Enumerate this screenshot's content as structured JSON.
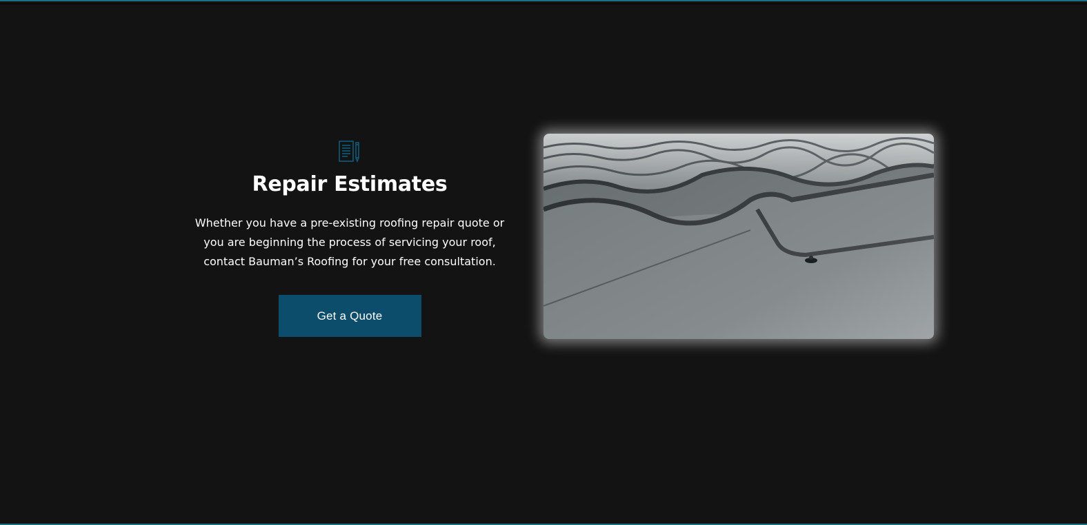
{
  "section": {
    "icon": "document-pencil-icon",
    "title": "Repair Estimates",
    "description": "Whether you have a pre-existing roofing repair quote or you are beginning the process of servicing your roof, contact Bauman’s Roofing for your free consultation.",
    "button_label": "Get a Quote"
  },
  "image": {
    "subject": "metal roof tiles photo"
  },
  "colors": {
    "background": "#131313",
    "accent": "#0b4d6b",
    "icon": "#0e5d7e",
    "border": "#1f6f82",
    "text": "#ffffff"
  }
}
